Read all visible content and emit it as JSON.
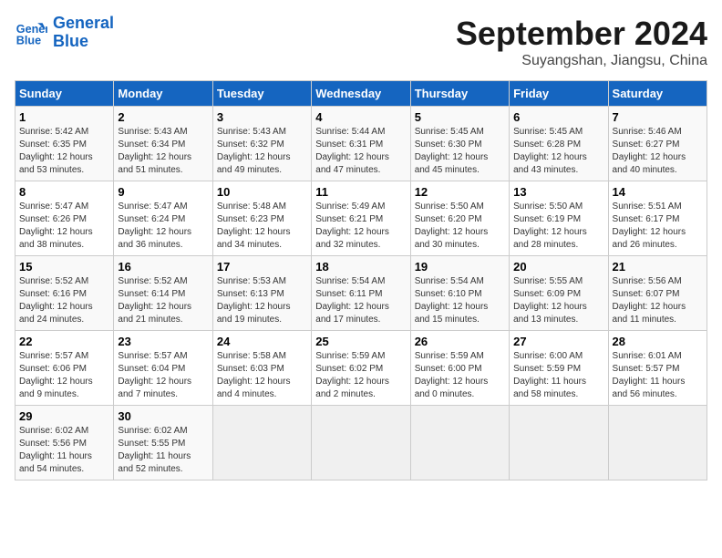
{
  "header": {
    "logo_line1": "General",
    "logo_line2": "Blue",
    "month": "September 2024",
    "location": "Suyangshan, Jiangsu, China"
  },
  "weekdays": [
    "Sunday",
    "Monday",
    "Tuesday",
    "Wednesday",
    "Thursday",
    "Friday",
    "Saturday"
  ],
  "weeks": [
    [
      {
        "day": "1",
        "detail": "Sunrise: 5:42 AM\nSunset: 6:35 PM\nDaylight: 12 hours\nand 53 minutes."
      },
      {
        "day": "2",
        "detail": "Sunrise: 5:43 AM\nSunset: 6:34 PM\nDaylight: 12 hours\nand 51 minutes."
      },
      {
        "day": "3",
        "detail": "Sunrise: 5:43 AM\nSunset: 6:32 PM\nDaylight: 12 hours\nand 49 minutes."
      },
      {
        "day": "4",
        "detail": "Sunrise: 5:44 AM\nSunset: 6:31 PM\nDaylight: 12 hours\nand 47 minutes."
      },
      {
        "day": "5",
        "detail": "Sunrise: 5:45 AM\nSunset: 6:30 PM\nDaylight: 12 hours\nand 45 minutes."
      },
      {
        "day": "6",
        "detail": "Sunrise: 5:45 AM\nSunset: 6:28 PM\nDaylight: 12 hours\nand 43 minutes."
      },
      {
        "day": "7",
        "detail": "Sunrise: 5:46 AM\nSunset: 6:27 PM\nDaylight: 12 hours\nand 40 minutes."
      }
    ],
    [
      {
        "day": "8",
        "detail": "Sunrise: 5:47 AM\nSunset: 6:26 PM\nDaylight: 12 hours\nand 38 minutes."
      },
      {
        "day": "9",
        "detail": "Sunrise: 5:47 AM\nSunset: 6:24 PM\nDaylight: 12 hours\nand 36 minutes."
      },
      {
        "day": "10",
        "detail": "Sunrise: 5:48 AM\nSunset: 6:23 PM\nDaylight: 12 hours\nand 34 minutes."
      },
      {
        "day": "11",
        "detail": "Sunrise: 5:49 AM\nSunset: 6:21 PM\nDaylight: 12 hours\nand 32 minutes."
      },
      {
        "day": "12",
        "detail": "Sunrise: 5:50 AM\nSunset: 6:20 PM\nDaylight: 12 hours\nand 30 minutes."
      },
      {
        "day": "13",
        "detail": "Sunrise: 5:50 AM\nSunset: 6:19 PM\nDaylight: 12 hours\nand 28 minutes."
      },
      {
        "day": "14",
        "detail": "Sunrise: 5:51 AM\nSunset: 6:17 PM\nDaylight: 12 hours\nand 26 minutes."
      }
    ],
    [
      {
        "day": "15",
        "detail": "Sunrise: 5:52 AM\nSunset: 6:16 PM\nDaylight: 12 hours\nand 24 minutes."
      },
      {
        "day": "16",
        "detail": "Sunrise: 5:52 AM\nSunset: 6:14 PM\nDaylight: 12 hours\nand 21 minutes."
      },
      {
        "day": "17",
        "detail": "Sunrise: 5:53 AM\nSunset: 6:13 PM\nDaylight: 12 hours\nand 19 minutes."
      },
      {
        "day": "18",
        "detail": "Sunrise: 5:54 AM\nSunset: 6:11 PM\nDaylight: 12 hours\nand 17 minutes."
      },
      {
        "day": "19",
        "detail": "Sunrise: 5:54 AM\nSunset: 6:10 PM\nDaylight: 12 hours\nand 15 minutes."
      },
      {
        "day": "20",
        "detail": "Sunrise: 5:55 AM\nSunset: 6:09 PM\nDaylight: 12 hours\nand 13 minutes."
      },
      {
        "day": "21",
        "detail": "Sunrise: 5:56 AM\nSunset: 6:07 PM\nDaylight: 12 hours\nand 11 minutes."
      }
    ],
    [
      {
        "day": "22",
        "detail": "Sunrise: 5:57 AM\nSunset: 6:06 PM\nDaylight: 12 hours\nand 9 minutes."
      },
      {
        "day": "23",
        "detail": "Sunrise: 5:57 AM\nSunset: 6:04 PM\nDaylight: 12 hours\nand 7 minutes."
      },
      {
        "day": "24",
        "detail": "Sunrise: 5:58 AM\nSunset: 6:03 PM\nDaylight: 12 hours\nand 4 minutes."
      },
      {
        "day": "25",
        "detail": "Sunrise: 5:59 AM\nSunset: 6:02 PM\nDaylight: 12 hours\nand 2 minutes."
      },
      {
        "day": "26",
        "detail": "Sunrise: 5:59 AM\nSunset: 6:00 PM\nDaylight: 12 hours\nand 0 minutes."
      },
      {
        "day": "27",
        "detail": "Sunrise: 6:00 AM\nSunset: 5:59 PM\nDaylight: 11 hours\nand 58 minutes."
      },
      {
        "day": "28",
        "detail": "Sunrise: 6:01 AM\nSunset: 5:57 PM\nDaylight: 11 hours\nand 56 minutes."
      }
    ],
    [
      {
        "day": "29",
        "detail": "Sunrise: 6:02 AM\nSunset: 5:56 PM\nDaylight: 11 hours\nand 54 minutes."
      },
      {
        "day": "30",
        "detail": "Sunrise: 6:02 AM\nSunset: 5:55 PM\nDaylight: 11 hours\nand 52 minutes."
      },
      {
        "day": "",
        "detail": ""
      },
      {
        "day": "",
        "detail": ""
      },
      {
        "day": "",
        "detail": ""
      },
      {
        "day": "",
        "detail": ""
      },
      {
        "day": "",
        "detail": ""
      }
    ]
  ]
}
